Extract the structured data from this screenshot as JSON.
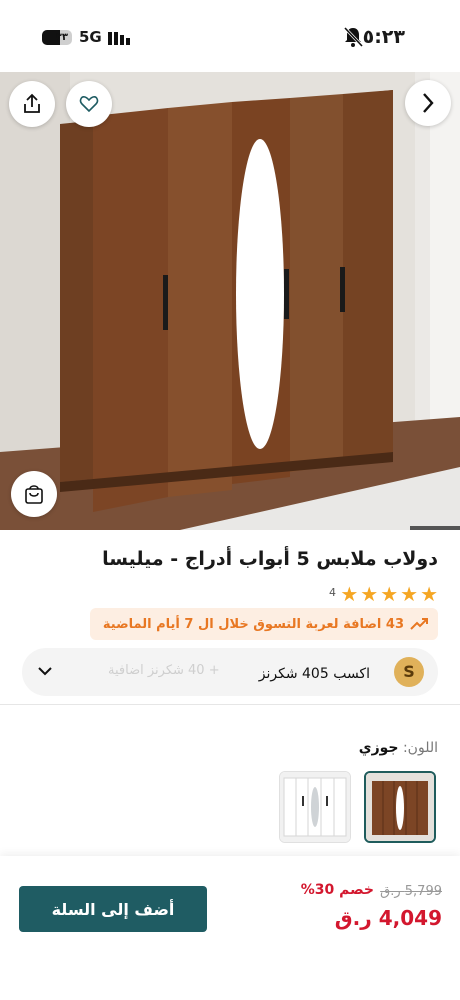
{
  "status_bar": {
    "time": "٥:٢٣",
    "network": "5G",
    "battery": "٣٣"
  },
  "product": {
    "title": "دولاب ملابس 5 أبواب أدراج - ميليسا",
    "rating": 5,
    "review_count": "4",
    "promo": "43 اضافة لعربة التسوق خلال ال 7 أيام الماضية",
    "points_text": "اكسب 405 شكرنز",
    "points_sub": "+ 40 شكرنز اضافية",
    "points_logo": "S",
    "color_label": "اللون:",
    "color_value": "جوزي"
  },
  "pricing": {
    "old_price": "5,799 ر.ق",
    "discount": "خصم 30%",
    "price": "4,049 ر.ق",
    "add_to_cart": "أضف إلى السلة"
  },
  "colors": {
    "accent": "#1f5c63",
    "sale": "#d3172e",
    "promo": "#e87722",
    "star": "#f5a623"
  },
  "icons": [
    "share-icon",
    "heart-icon",
    "chevron-right-icon",
    "shopping-bag-icon",
    "trending-up-icon",
    "chevron-down-icon",
    "bell-slash-icon"
  ]
}
